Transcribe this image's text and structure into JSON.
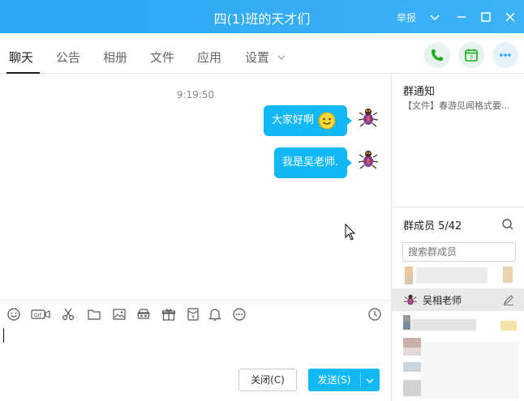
{
  "window": {
    "title": "四(1)班的天才们",
    "report_label": "举报"
  },
  "tabs": [
    {
      "label": "聊天"
    },
    {
      "label": "公告"
    },
    {
      "label": "相册"
    },
    {
      "label": "文件"
    },
    {
      "label": "应用"
    },
    {
      "label": "设置"
    }
  ],
  "chat": {
    "timestamp": "9:19:50",
    "messages": [
      {
        "text": "大家好啊",
        "has_emoji": true,
        "emoji": "smiley-icon"
      },
      {
        "text": "我是吴老师."
      }
    ]
  },
  "toolbar_icons": [
    "emoji-icon",
    "gif-icon",
    "scissors-icon",
    "folder-icon",
    "image-icon",
    "mask-icon",
    "gift-icon",
    "red-packet-icon",
    "bell-icon",
    "more-icon",
    "history-clock-icon"
  ],
  "buttons": {
    "close": "关闭(C)",
    "send": "发送(S)"
  },
  "sidebar": {
    "notice_title": "群通知",
    "notice_text": "【文件】春游见闻格式要...",
    "members_title": "群成员 5/42",
    "member_search_placeholder": "搜索群成员",
    "selected_member": "吴相老师"
  },
  "colors": {
    "title_bar": "#2aa6f3",
    "bubble": "#12b7f5",
    "accent_green": "#1aad19"
  }
}
